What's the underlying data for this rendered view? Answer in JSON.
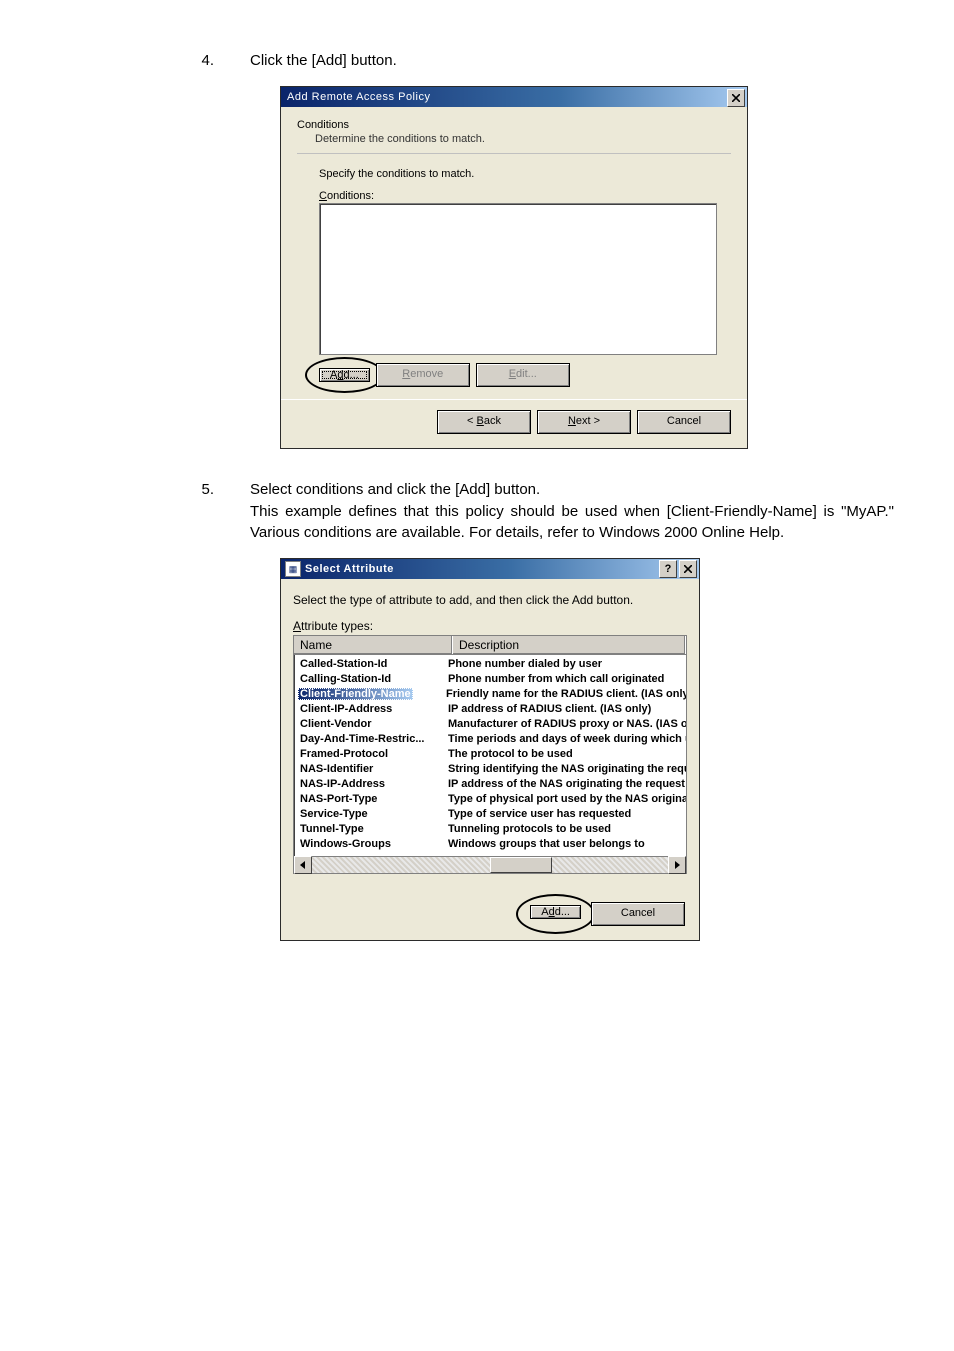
{
  "step4": {
    "num": "4.",
    "text": "Click the [Add] button."
  },
  "dlg1": {
    "title": "Add Remote Access Policy",
    "header": "Conditions",
    "header_sub": "Determine the conditions to match.",
    "specify": "Specify the conditions to match.",
    "cond_label": "Conditions:",
    "add": "Add...",
    "remove": "Remove",
    "edit": "Edit...",
    "back": "< Back",
    "next": "Next >",
    "cancel": "Cancel"
  },
  "step5": {
    "num": "5.",
    "line1": "Select conditions and click the [Add] button.",
    "line2": "This example defines that this policy should be used when [Client-Friendly-Name] is \"MyAP.\"  Various conditions are available.  For details, refer to Windows 2000 Online Help."
  },
  "dlg2": {
    "title": "Select Attribute",
    "prompt": "Select the type of attribute to add, and then click the Add button.",
    "attr_label": "Attribute types:",
    "col_name": "Name",
    "col_desc": "Description",
    "rows": [
      {
        "name": "Called-Station-Id",
        "desc": "Phone number dialed by user"
      },
      {
        "name": "Calling-Station-Id",
        "desc": "Phone number from which call originated"
      },
      {
        "name": "Client-Friendly-Name",
        "desc": "Friendly name for the RADIUS client. (IAS only)",
        "selected": true
      },
      {
        "name": "Client-IP-Address",
        "desc": "IP address of RADIUS client. (IAS only)"
      },
      {
        "name": "Client-Vendor",
        "desc": "Manufacturer of RADIUS proxy or NAS. (IAS onl"
      },
      {
        "name": "Day-And-Time-Restric...",
        "desc": "Time periods and days of week during which use"
      },
      {
        "name": "Framed-Protocol",
        "desc": "The protocol to be used"
      },
      {
        "name": "NAS-Identifier",
        "desc": "String identifying the NAS originating the request"
      },
      {
        "name": "NAS-IP-Address",
        "desc": "IP address of the NAS originating the request (IA"
      },
      {
        "name": "NAS-Port-Type",
        "desc": "Type of physical port used by the NAS originatin"
      },
      {
        "name": "Service-Type",
        "desc": "Type of service user has requested"
      },
      {
        "name": "Tunnel-Type",
        "desc": "Tunneling protocols to be used"
      },
      {
        "name": "Windows-Groups",
        "desc": "Windows groups that user belongs to"
      }
    ],
    "add": "Add...",
    "cancel": "Cancel"
  }
}
